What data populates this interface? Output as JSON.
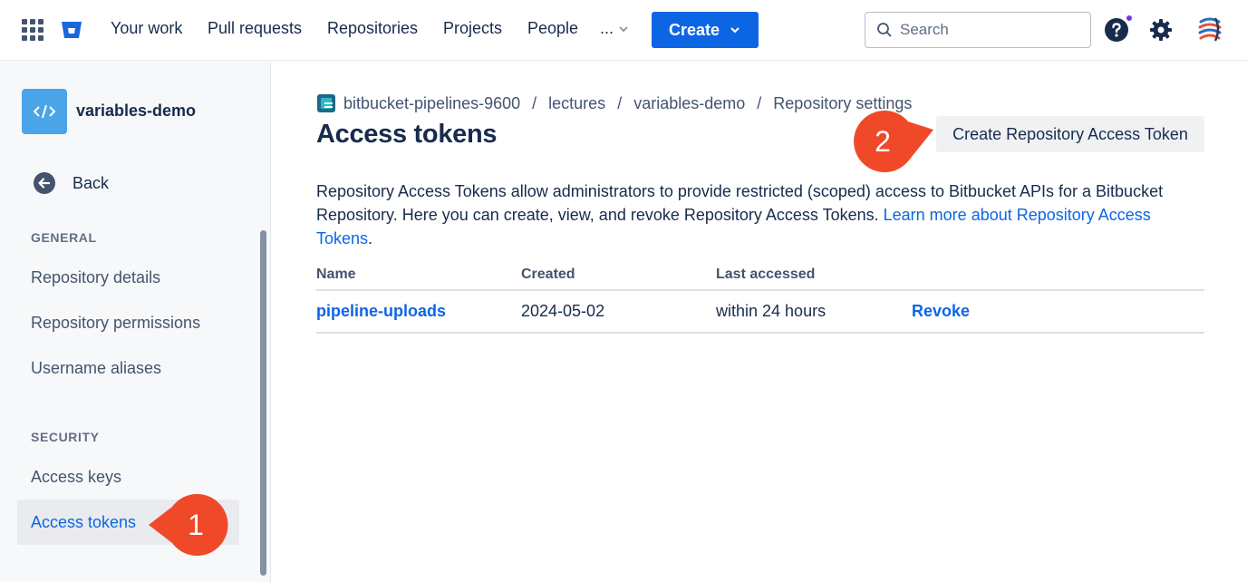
{
  "topnav": {
    "items": [
      "Your work",
      "Pull requests",
      "Repositories",
      "Projects",
      "People"
    ],
    "more_label": "...",
    "create_label": "Create",
    "search_placeholder": "Search"
  },
  "sidebar": {
    "repo_name": "variables-demo",
    "back_label": "Back",
    "general_heading": "GENERAL",
    "general_items": [
      "Repository details",
      "Repository permissions",
      "Username aliases"
    ],
    "security_heading": "SECURITY",
    "security_items": [
      "Access keys",
      "Access tokens"
    ],
    "active_item": "Access tokens"
  },
  "breadcrumb": [
    "bitbucket-pipelines-9600",
    "lectures",
    "variables-demo",
    "Repository settings"
  ],
  "page": {
    "title": "Access tokens",
    "create_token_label": "Create Repository Access Token",
    "description_text": "Repository Access Tokens allow administrators to provide restricted (scoped) access to Bitbucket APIs for a Bitbucket Repository. Here you can create, view, and revoke Repository Access Tokens. ",
    "description_link": "Learn more about Repository Access Tokens",
    "description_end": "."
  },
  "table": {
    "headers": [
      "Name",
      "Created",
      "Last accessed"
    ],
    "rows": [
      {
        "name": "pipeline-uploads",
        "created": "2024-05-02",
        "last_accessed": "within 24 hours",
        "action": "Revoke"
      }
    ]
  },
  "callouts": [
    "1",
    "2"
  ],
  "colors": {
    "primary": "#0c66e4",
    "callout": "#f0492a",
    "repo_avatar": "#4ba4e8",
    "notification_dot": "#6e3be0"
  }
}
